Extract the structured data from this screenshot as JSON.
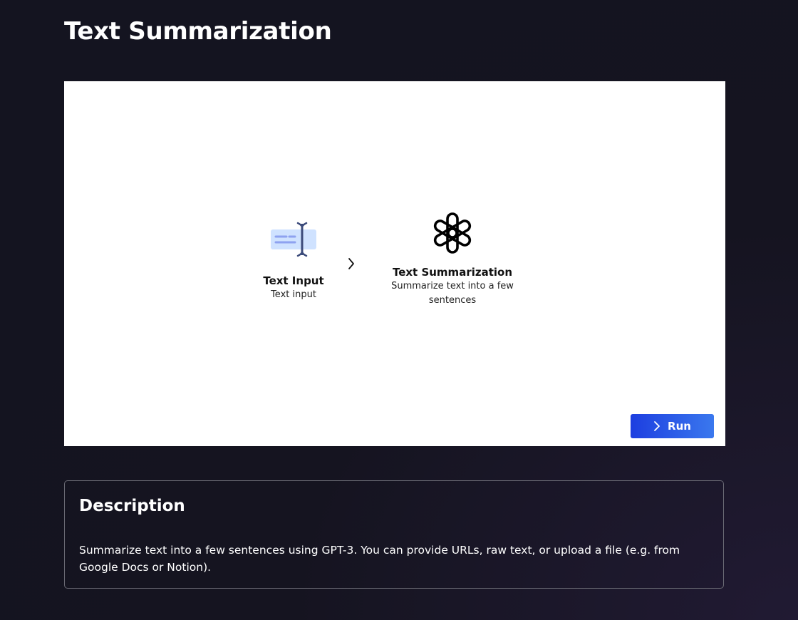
{
  "page": {
    "title": "Text Summarization"
  },
  "flow": {
    "nodes": [
      {
        "title": "Text Input",
        "description": "Text input",
        "icon": "text-cursor-input-icon"
      },
      {
        "title": "Text Summarization",
        "description": "Summarize text into a few sentences",
        "icon": "openai-logo-icon"
      }
    ],
    "connector_icon": "chevron-right-icon"
  },
  "run_button": {
    "label": "Run",
    "icon": "chevron-right-icon"
  },
  "description": {
    "heading": "Description",
    "text": "Summarize text into a few sentences using GPT-3. You can provide URLs, raw text, or upload a file (e.g. from Google Docs or Notion)."
  },
  "colors": {
    "background": "#151420",
    "canvas": "#ffffff",
    "run_button_start": "#1d3ee0",
    "run_button_end": "#3a78ee",
    "input_icon_fill": "#cfe2ff",
    "input_icon_stroke": "#3b4a7a"
  }
}
